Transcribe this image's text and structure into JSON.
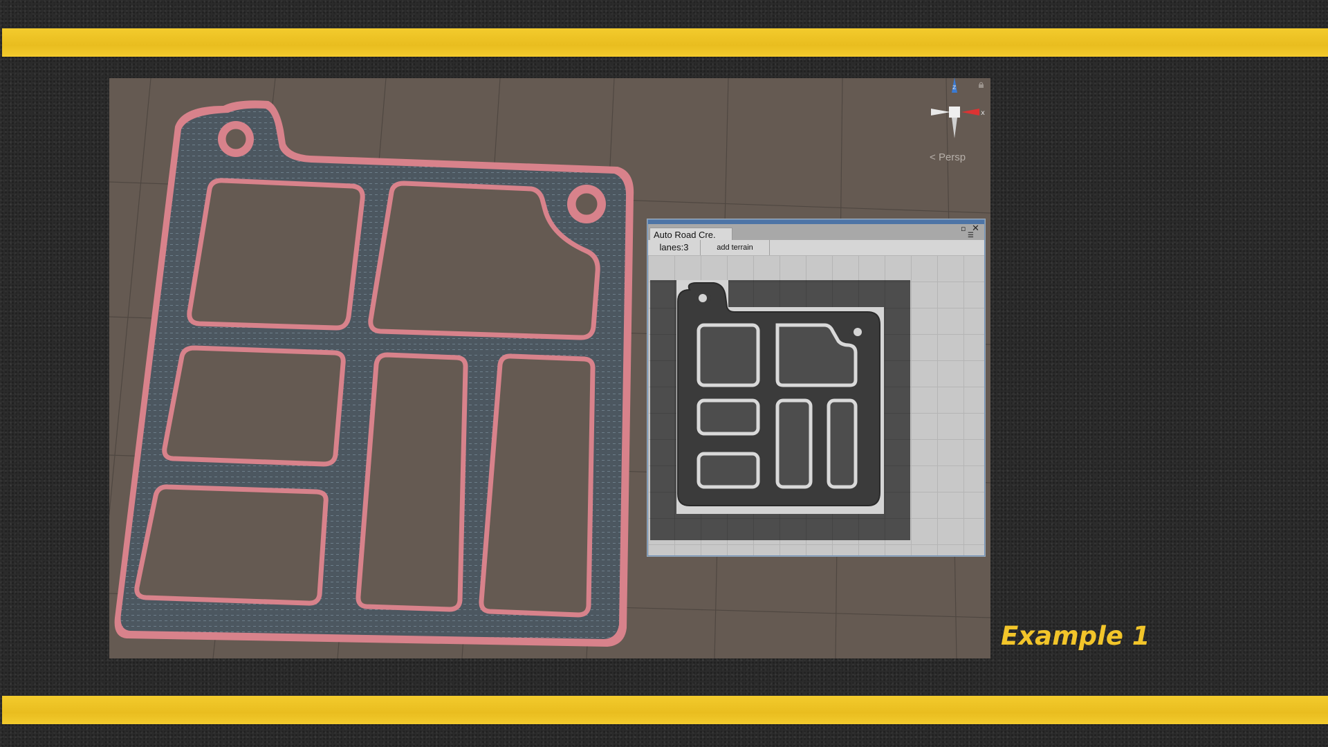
{
  "scene_view": {
    "projection_label": "Persp",
    "axes": {
      "z": "z",
      "x": "x"
    }
  },
  "road_window": {
    "title": "Auto Road Cre.",
    "toolbar": {
      "lanes_label": "lanes:3",
      "add_terrain_label": "add terrain"
    }
  },
  "caption": "Example 1",
  "colors": {
    "stripe": "#f3cb2d",
    "asphalt": "#2b2b2b",
    "viewport_ground": "#655a52",
    "road_surface": "#4f5a62",
    "curb": "#d8828b",
    "caption": "#f2c52a"
  },
  "icons": [
    "lock-icon",
    "orientation-gizmo",
    "maximize-icon",
    "close-icon",
    "menu-icon",
    "back-chevron-icon"
  ]
}
